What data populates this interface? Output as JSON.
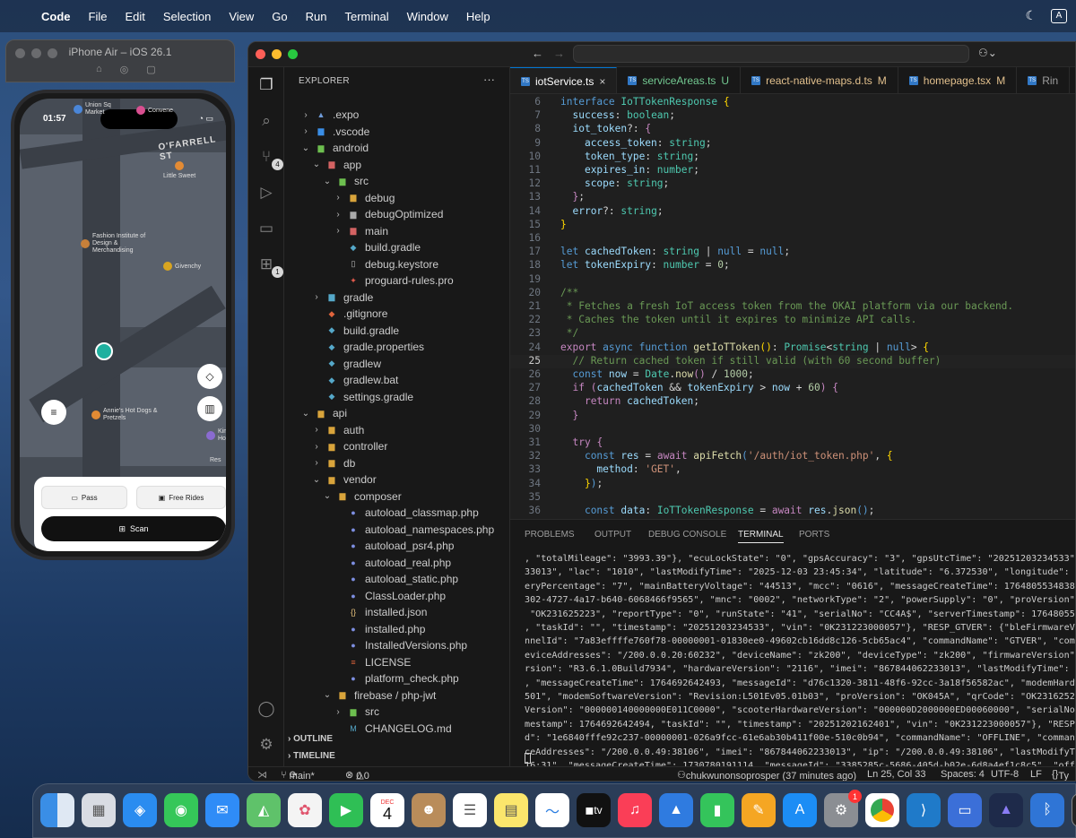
{
  "menubar": {
    "items": [
      "Code",
      "File",
      "Edit",
      "Selection",
      "View",
      "Go",
      "Run",
      "Terminal",
      "Window",
      "Help"
    ]
  },
  "simulator": {
    "title": "iPhone Air – iOS 26.1",
    "time": "01:57",
    "map": {
      "street": "O'FARRELL ST",
      "pois": {
        "union_square": "Union Sq Market",
        "convene": "Convene",
        "little_sweet": "Little Sweet",
        "fidm": "Fashion Institute of Design & Merchandising",
        "givenchy": "Givenchy",
        "annies": "Annie's Hot Dogs & Pretzels",
        "kimpton": "Kimp Hotel",
        "res": "Res"
      }
    },
    "card": {
      "pass_label": "Pass",
      "free_rides_label": "Free Rides",
      "scan_label": "Scan"
    }
  },
  "explorer": {
    "title": "EXPLORER",
    "tree": [
      {
        "label": ".expo",
        "depth": 0,
        "chev": "›",
        "icon": "expo"
      },
      {
        "label": ".vscode",
        "depth": 0,
        "chev": "›",
        "icon": "vscode"
      },
      {
        "label": "android",
        "depth": 0,
        "chev": "⌄",
        "icon": "android"
      },
      {
        "label": "app",
        "depth": 1,
        "chev": "⌄",
        "icon": "app"
      },
      {
        "label": "src",
        "depth": 2,
        "chev": "⌄",
        "icon": "src"
      },
      {
        "label": "debug",
        "depth": 3,
        "chev": "›",
        "icon": "folder"
      },
      {
        "label": "debugOptimized",
        "depth": 3,
        "chev": "›",
        "icon": "folder-gray"
      },
      {
        "label": "main",
        "depth": 3,
        "chev": "›",
        "icon": "main"
      },
      {
        "label": "build.gradle",
        "depth": 3,
        "chev": "",
        "icon": "gradle"
      },
      {
        "label": "debug.keystore",
        "depth": 3,
        "chev": "",
        "icon": "file"
      },
      {
        "label": "proguard-rules.pro",
        "depth": 3,
        "chev": "",
        "icon": "proguard"
      },
      {
        "label": "gradle",
        "depth": 1,
        "chev": "›",
        "icon": "gradle-folder"
      },
      {
        "label": ".gitignore",
        "depth": 1,
        "chev": "",
        "icon": "git"
      },
      {
        "label": "build.gradle",
        "depth": 1,
        "chev": "",
        "icon": "gradle"
      },
      {
        "label": "gradle.properties",
        "depth": 1,
        "chev": "",
        "icon": "gradle"
      },
      {
        "label": "gradlew",
        "depth": 1,
        "chev": "",
        "icon": "gradle"
      },
      {
        "label": "gradlew.bat",
        "depth": 1,
        "chev": "",
        "icon": "gradle"
      },
      {
        "label": "settings.gradle",
        "depth": 1,
        "chev": "",
        "icon": "gradle"
      },
      {
        "label": "api",
        "depth": 0,
        "chev": "⌄",
        "icon": "api"
      },
      {
        "label": "auth",
        "depth": 1,
        "chev": "›",
        "icon": "folder"
      },
      {
        "label": "controller",
        "depth": 1,
        "chev": "›",
        "icon": "folder"
      },
      {
        "label": "db",
        "depth": 1,
        "chev": "›",
        "icon": "folder"
      },
      {
        "label": "vendor",
        "depth": 1,
        "chev": "⌄",
        "icon": "folder"
      },
      {
        "label": "composer",
        "depth": 2,
        "chev": "⌄",
        "icon": "composer"
      },
      {
        "label": "autoload_classmap.php",
        "depth": 3,
        "chev": "",
        "icon": "php"
      },
      {
        "label": "autoload_namespaces.php",
        "depth": 3,
        "chev": "",
        "icon": "php"
      },
      {
        "label": "autoload_psr4.php",
        "depth": 3,
        "chev": "",
        "icon": "php"
      },
      {
        "label": "autoload_real.php",
        "depth": 3,
        "chev": "",
        "icon": "php"
      },
      {
        "label": "autoload_static.php",
        "depth": 3,
        "chev": "",
        "icon": "php"
      },
      {
        "label": "ClassLoader.php",
        "depth": 3,
        "chev": "",
        "icon": "php"
      },
      {
        "label": "installed.json",
        "depth": 3,
        "chev": "",
        "icon": "json"
      },
      {
        "label": "installed.php",
        "depth": 3,
        "chev": "",
        "icon": "php"
      },
      {
        "label": "InstalledVersions.php",
        "depth": 3,
        "chev": "",
        "icon": "php"
      },
      {
        "label": "LICENSE",
        "depth": 3,
        "chev": "",
        "icon": "license"
      },
      {
        "label": "platform_check.php",
        "depth": 3,
        "chev": "",
        "icon": "php"
      },
      {
        "label": "firebase / php-jwt",
        "depth": 2,
        "chev": "⌄",
        "icon": "folder"
      },
      {
        "label": "src",
        "depth": 3,
        "chev": "›",
        "icon": "src"
      },
      {
        "label": "CHANGELOG.md",
        "depth": 3,
        "chev": "",
        "icon": "md"
      }
    ],
    "outline": "OUTLINE",
    "timeline": "TIMELINE"
  },
  "activity_badges": {
    "source_control": "4",
    "extensions": "1"
  },
  "tabs": [
    {
      "label": "iotService.ts",
      "status": "",
      "active": true,
      "icon": "ts"
    },
    {
      "label": "serviceAreas.ts",
      "status": "U",
      "active": false,
      "icon": "ts"
    },
    {
      "label": "react-native-maps.d.ts",
      "status": "M",
      "active": false,
      "icon": "dts"
    },
    {
      "label": "homepage.tsx",
      "status": "M",
      "active": false,
      "icon": "tsx"
    },
    {
      "label": "Rin",
      "status": "",
      "active": false,
      "icon": "tsx"
    }
  ],
  "code_lines": [
    {
      "n": "6",
      "html": "<span class=\"k\">interface</span> <span class=\"t\">IoTTokenResponse</span> <span class=\"b\">{</span>"
    },
    {
      "n": "7",
      "html": "  <span class=\"p\">success</span><span class=\"d\">: </span><span class=\"t\">boolean</span><span class=\"d\">;</span>"
    },
    {
      "n": "8",
      "html": "  <span class=\"p\">iot_token</span><span class=\"d\">?: </span><span class=\"kc\">{</span>"
    },
    {
      "n": "9",
      "html": "    <span class=\"p\">access_token</span><span class=\"d\">: </span><span class=\"t\">string</span><span class=\"d\">;</span>"
    },
    {
      "n": "10",
      "html": "    <span class=\"p\">token_type</span><span class=\"d\">: </span><span class=\"t\">string</span><span class=\"d\">;</span>"
    },
    {
      "n": "11",
      "html": "    <span class=\"p\">expires_in</span><span class=\"d\">: </span><span class=\"t\">number</span><span class=\"d\">;</span>"
    },
    {
      "n": "12",
      "html": "    <span class=\"p\">scope</span><span class=\"d\">: </span><span class=\"t\">string</span><span class=\"d\">;</span>"
    },
    {
      "n": "13",
      "html": "  <span class=\"kc\">}</span><span class=\"d\">;</span>"
    },
    {
      "n": "14",
      "html": "  <span class=\"p\">error</span><span class=\"d\">?: </span><span class=\"t\">string</span><span class=\"d\">;</span>"
    },
    {
      "n": "15",
      "html": "<span class=\"b\">}</span>"
    },
    {
      "n": "16",
      "html": ""
    },
    {
      "n": "17",
      "html": "<span class=\"k\">let</span> <span class=\"p\">cachedToken</span><span class=\"d\">: </span><span class=\"t\">string</span><span class=\"d\"> | </span><span class=\"k\">null</span><span class=\"d\"> = </span><span class=\"k\">null</span><span class=\"d\">;</span>"
    },
    {
      "n": "18",
      "html": "<span class=\"k\">let</span> <span class=\"p\">tokenExpiry</span><span class=\"d\">: </span><span class=\"t\">number</span><span class=\"d\"> = </span><span class=\"n\">0</span><span class=\"d\">;</span>"
    },
    {
      "n": "19",
      "html": ""
    },
    {
      "n": "20",
      "html": "<span class=\"c\">/**</span>"
    },
    {
      "n": "21",
      "html": "<span class=\"c\"> * Fetches a fresh IoT access token from the OKAI platform via our backend.</span>"
    },
    {
      "n": "22",
      "html": "<span class=\"c\"> * Caches the token until it expires to minimize API calls.</span>"
    },
    {
      "n": "23",
      "html": "<span class=\"c\"> */</span>"
    },
    {
      "n": "24",
      "html": "<span class=\"kc\">export</span> <span class=\"k\">async</span> <span class=\"k\">function</span> <span class=\"f\">getIoTToken</span><span class=\"b\">()</span><span class=\"d\">: </span><span class=\"t\">Promise</span><span class=\"d\">&lt;</span><span class=\"t\">string</span><span class=\"d\"> | </span><span class=\"k\">null</span><span class=\"d\">&gt; </span><span class=\"b\">{</span>"
    },
    {
      "n": "25",
      "html": "  <span class=\"c\">// Return cached token if still valid (with 60 second buffer)</span>"
    },
    {
      "n": "26",
      "html": "  <span class=\"k\">const</span> <span class=\"p\">now</span><span class=\"d\"> = </span><span class=\"t\">Date</span><span class=\"d\">.</span><span class=\"f\">now</span><span class=\"kc\">()</span><span class=\"d\"> / </span><span class=\"n\">1000</span><span class=\"d\">;</span>"
    },
    {
      "n": "27",
      "html": "  <span class=\"kc\">if</span> <span class=\"kc\">(</span><span class=\"p\">cachedToken</span><span class=\"d\"> &amp;&amp; </span><span class=\"p\">tokenExpiry</span><span class=\"d\"> &gt; </span><span class=\"p\">now</span><span class=\"d\"> + </span><span class=\"n\">60</span><span class=\"kc\">)</span> <span class=\"kc\">{</span>"
    },
    {
      "n": "28",
      "html": "    <span class=\"kc\">return</span> <span class=\"p\">cachedToken</span><span class=\"d\">;</span>"
    },
    {
      "n": "29",
      "html": "  <span class=\"kc\">}</span>"
    },
    {
      "n": "30",
      "html": ""
    },
    {
      "n": "31",
      "html": "  <span class=\"kc\">try</span> <span class=\"kc\">{</span>"
    },
    {
      "n": "32",
      "html": "    <span class=\"k\">const</span> <span class=\"p\">res</span><span class=\"d\"> = </span><span class=\"kc\">await</span> <span class=\"f\">apiFetch</span><span class=\"k\">(</span><span class=\"s\">'/auth/iot_token.php'</span><span class=\"d\">, </span><span class=\"b\">{</span>"
    },
    {
      "n": "33",
      "html": "      <span class=\"p\">method</span><span class=\"d\">: </span><span class=\"s\">'GET'</span><span class=\"d\">,</span>"
    },
    {
      "n": "34",
      "html": "    <span class=\"b\">}</span><span class=\"k\">)</span><span class=\"d\">;</span>"
    },
    {
      "n": "35",
      "html": ""
    },
    {
      "n": "36",
      "html": "    <span class=\"k\">const</span> <span class=\"p\">data</span><span class=\"d\">: </span><span class=\"t\">IoTTokenResponse</span><span class=\"d\"> = </span><span class=\"kc\">await</span> <span class=\"p\">res</span><span class=\"d\">.</span><span class=\"f\">json</span><span class=\"k\">()</span><span class=\"d\">;</span>"
    }
  ],
  "panel": {
    "tabs": [
      "PROBLEMS",
      "OUTPUT",
      "DEBUG CONSOLE",
      "TERMINAL",
      "PORTS"
    ],
    "active_tab": "TERMINAL",
    "terminal_lines": [
      ", \"totalMileage\": \"3993.39\"}, \"ecuLockState\": \"0\", \"gpsAccuracy\": \"3\", \"gpsUtcTime\": \"20251203234533\", \"",
      "33013\", \"lac\": \"1010\", \"lastModifyTime\": \"2025-12-03 23:45:34\", \"latitude\": \"6.372530\", \"longitude\": \"2.4",
      "eryPercentage\": \"7\", \"mainBatteryVoltage\": \"44513\", \"mcc\": \"0616\", \"messageCreateTime\": 1764805534838, \"m",
      "302-4727-4a17-b640-6068466f9565\", \"mnc\": \"0002\", \"networkType\": \"2\", \"powerSupply\": \"0\", \"proVersion\": \"0",
      " \"OK231625223\", \"reportType\": \"0\", \"runState\": \"41\", \"serialNo\": \"CC4A$\", \"serverTimestamp\": 176480553483",
      ", \"taskId\": \"\", \"timestamp\": \"20251203234533\", \"vin\": \"0K231223000057\"}, \"RESP_GTVER\": {\"bleFirmwareVersi",
      "nnelId\": \"7a83effffe760f78-00000001-01830ee0-49602cb16dd8c126-5cb65ac4\", \"commandName\": \"GTVER\", \"command",
      "eviceAddresses\": \"/200.0.0.20:60232\", \"deviceName\": \"zk200\", \"deviceType\": \"zk200\", \"firmwareVersion\": \"",
      "rsion\": \"R3.6.1.0Build7934\", \"hardwareVersion\": \"2116\", \"imei\": \"867844062233013\", \"lastModifyTime\": \"202",
      ", \"messageCreateTime\": 1764692642493, \"messageId\": \"d76c1320-3811-48f6-92cc-3a18f56582ac\", \"modemHardwa",
      "501\", \"modemSoftwareVersion\": \"Revision:L501Ev05.01b03\", \"proVersion\": \"OK045A\", \"qrCode\": \"OK231625223\"",
      "Version\": \"000000140000000E011C0000\", \"scooterHardwareVersion\": \"000000D2000000ED00060000\", \"serialNo\": \"",
      "mestamp\": 1764692642494, \"taskId\": \"\", \"timestamp\": \"20251202162401\", \"vin\": \"0K231223000057\"}, \"RESP_OF",
      "d\": \"1e6840fffe92c237-00000001-026a9fcc-61e6ab30b411f00e-510c0b94\", \"commandName\": \"OFFLINE\", \"commandTyp",
      "ceAddresses\": \"/200.0.0.49:38106\", \"imei\": \"867844062233013\", \"ip\": \"/200.0.0.49:38106\", \"lastModifyTime",
      "16:31\", \"messageCreateTime\": 1730780191114, \"messageId\": \"3385285c-5686-405d-b02e-6d8a4ef1c8c5\", \"offlin",
      "114, \"proVersion\": \"MONITORING\", \"serialNo\": \"0\", \"serverTimestamp\": 1730780191115}, \"Vehicle\": {\"create",
      "67, \"firstConnectionTime\": 1730779046867, \"imei\": \"867844062233013\", \"iotPassword\": \"Okai\", \"offlineTime",
      "\"onlineState\": \"on\", \"onlineTime\": 1764692496796, \"status\": \"enable\", \"updateTime\": 1764692496796}}"
    ]
  },
  "statusbar": {
    "branch": "main*",
    "errors": "0",
    "warnings": "0",
    "blame": "chukwunonsoprosper (37 minutes ago)",
    "position": "Ln 25, Col 33",
    "spaces": "Spaces: 4",
    "encoding": "UTF-8",
    "eol": "LF",
    "language": "Ty"
  },
  "dock": {
    "calendar_month": "DEC",
    "calendar_day": "4",
    "settings_badge": "1",
    "tv_label": "tv"
  }
}
